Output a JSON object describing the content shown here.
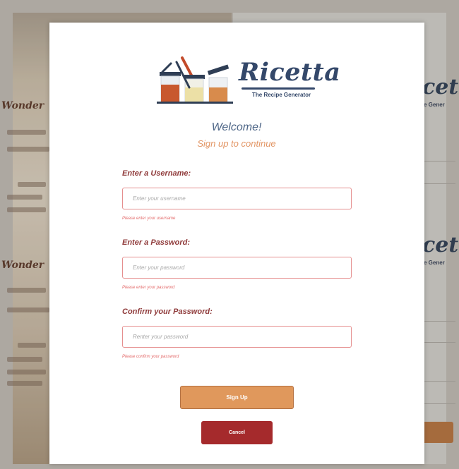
{
  "background": {
    "side_title_1": "Wonder",
    "side_title_2": "Wonder",
    "right_logo_1": "cett",
    "right_logo_2": "cett",
    "right_sub_1": "e Gener",
    "right_sub_2": "e Gener"
  },
  "modal": {
    "logo": {
      "title": "Ricetta",
      "tagline": "The Recipe Generator"
    },
    "welcome": "Welcome!",
    "subtitle": "Sign up to continue",
    "username": {
      "label": "Enter a Username:",
      "placeholder": "Enter your username",
      "error": "Please enter your username"
    },
    "password": {
      "label": "Enter a Password:",
      "placeholder": "Enter your password",
      "error": "Please enter your password"
    },
    "confirm": {
      "label": "Confirm your Password:",
      "placeholder": "Renter your password",
      "error": "Please confirm your password"
    },
    "signup_label": "Sign Up",
    "cancel_label": "Cancel"
  },
  "colors": {
    "accent": "#e0985c",
    "danger": "#a52a2c",
    "label": "#8f3a3a",
    "heading": "#4e6687"
  }
}
